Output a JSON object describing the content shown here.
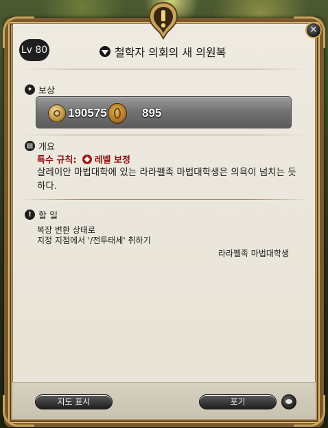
{
  "quest": {
    "level_label": "Lv 80",
    "title": "철학자 의회의 새 의원복"
  },
  "rewards": {
    "heading": "보상",
    "gil_amount": "190575",
    "coin_amount": "895"
  },
  "overview": {
    "heading": "개요",
    "special_rule_label": "특수 규칙:",
    "special_rule_value": "레벨 보정",
    "description": "살레이안 마법대학에 있는 라라펠족 마법대학생은 의욕이 넘치는 듯하다."
  },
  "todo": {
    "heading": "할 일",
    "lines": [
      "복장 변환 상태로",
      "지정 지점에서 '/전투태세' 취하기"
    ],
    "npc": "라라펠족 마법대학생"
  },
  "buttons": {
    "map": "지도 표시",
    "abandon": "포기"
  },
  "colors": {
    "panel": "#ECE8DE",
    "frame_gold": "#CAA35C",
    "special_rule_red": "#8D1010",
    "reward_box": "#6D6D6D"
  }
}
